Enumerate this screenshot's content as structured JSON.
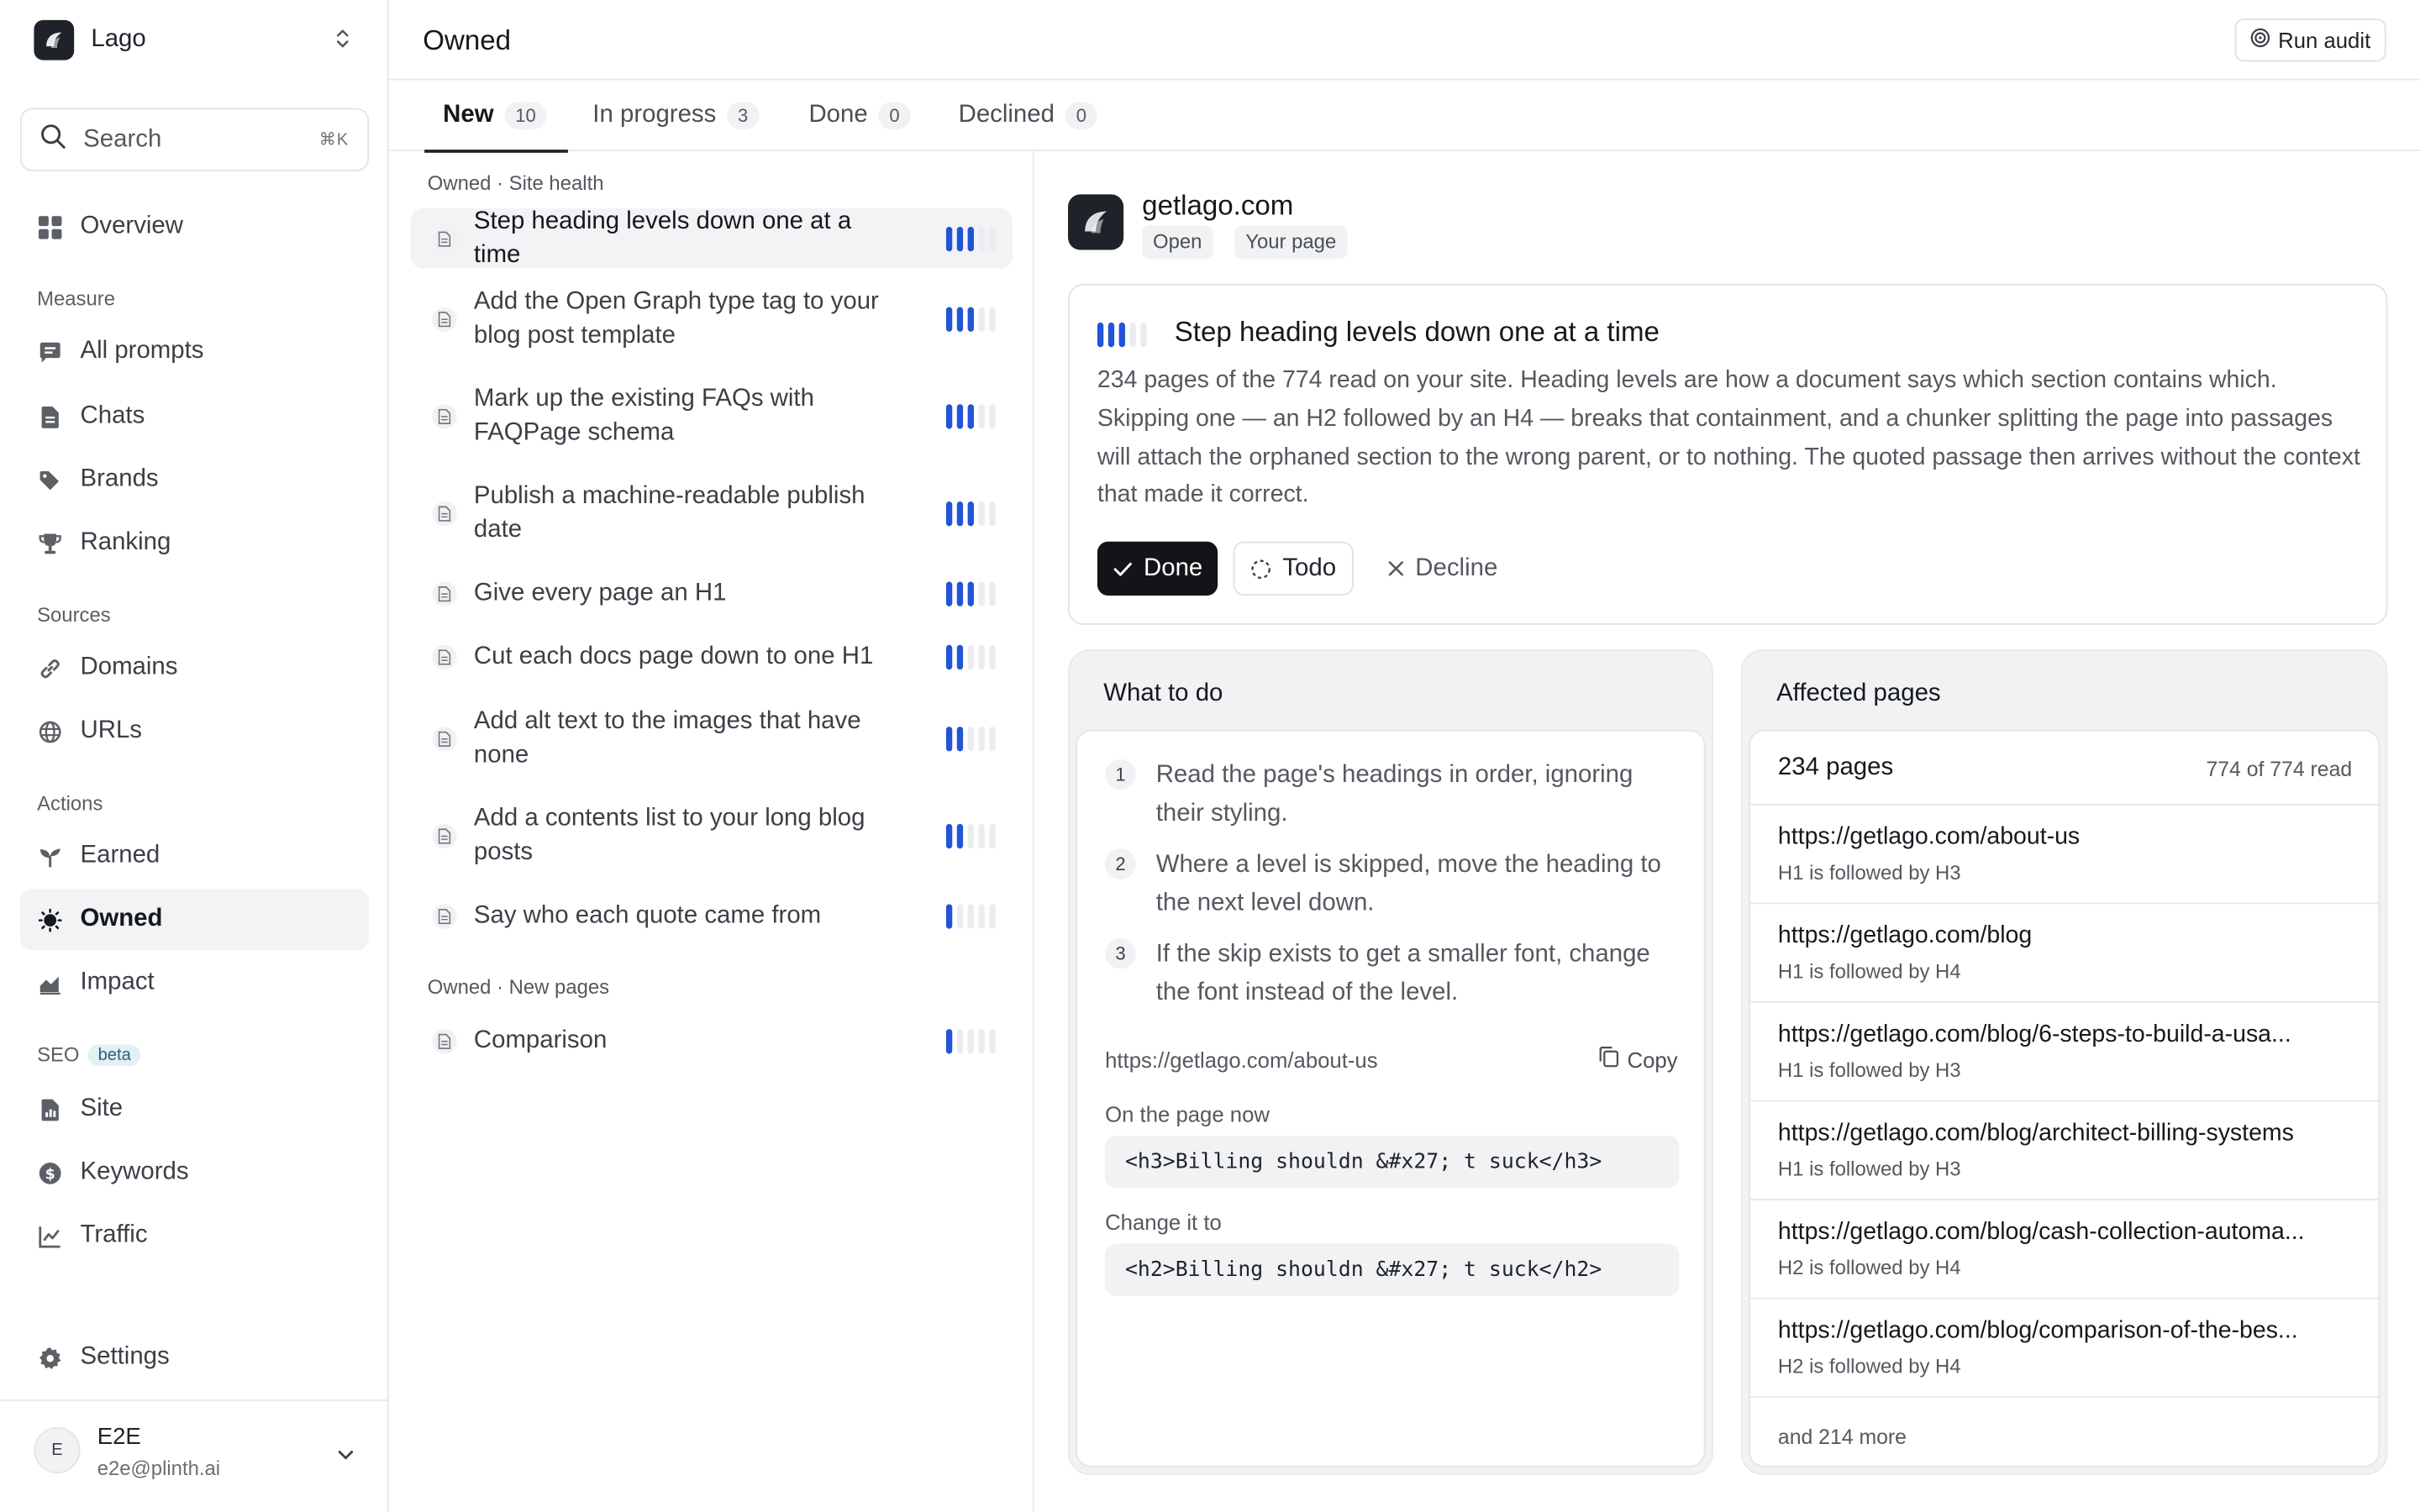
{
  "workspace": {
    "name": "Lago"
  },
  "search": {
    "label": "Search",
    "shortcut": "⌘K"
  },
  "nav": {
    "overview": "Overview",
    "measure_label": "Measure",
    "all_prompts": "All prompts",
    "chats": "Chats",
    "brands": "Brands",
    "ranking": "Ranking",
    "sources_label": "Sources",
    "domains": "Domains",
    "urls": "URLs",
    "actions_label": "Actions",
    "earned": "Earned",
    "owned": "Owned",
    "impact": "Impact",
    "seo_label": "SEO",
    "seo_badge": "beta",
    "site": "Site",
    "keywords": "Keywords",
    "traffic": "Traffic",
    "settings": "Settings"
  },
  "user": {
    "initial": "E",
    "name": "E2E",
    "email": "e2e@plinth.ai"
  },
  "header": {
    "title": "Owned",
    "run_audit": "Run audit"
  },
  "tabs": [
    {
      "label": "New",
      "count": "10"
    },
    {
      "label": "In progress",
      "count": "3"
    },
    {
      "label": "Done",
      "count": "0"
    },
    {
      "label": "Declined",
      "count": "0"
    }
  ],
  "groups": {
    "site_health": "Owned · Site health",
    "new_pages": "Owned · New pages"
  },
  "recommendations": [
    {
      "title": "Step heading levels down one at a time",
      "level": 3
    },
    {
      "title": "Add the Open Graph type tag to your blog post template",
      "level": 3
    },
    {
      "title": "Mark up the existing FAQs with FAQPage schema",
      "level": 3
    },
    {
      "title": "Publish a machine-readable publish date",
      "level": 3
    },
    {
      "title": "Give every page an H1",
      "level": 3
    },
    {
      "title": "Cut each docs page down to one H1",
      "level": 2
    },
    {
      "title": "Add alt text to the images that have none",
      "level": 2
    },
    {
      "title": "Add a contents list to your long blog posts",
      "level": 2
    },
    {
      "title": "Say who each quote came from",
      "level": 1
    },
    {
      "title": "Comparison",
      "level": 1
    }
  ],
  "detail": {
    "site": "getlago.com",
    "chips": [
      "Open",
      "Your page"
    ],
    "title": "Step heading levels down one at a time",
    "level": 3,
    "body": "234 pages of the 774 read on your site. Heading levels are how a document says which section contains which. Skipping one — an H2 followed by an H4 — breaks that containment, and a chunker splitting the page into passages will attach the orphaned section to the wrong parent, or to nothing. The quoted passage then arrives without the context that made it correct.",
    "buttons": {
      "done": "Done",
      "todo": "Todo",
      "decline": "Decline"
    }
  },
  "what_to_do": {
    "title": "What to do",
    "steps": [
      {
        "num": "1",
        "text": "Read the page's headings in order, ignoring their styling."
      },
      {
        "num": "2",
        "text": "Where a level is skipped, move the heading to the next level down."
      },
      {
        "num": "3",
        "text": "If the skip exists to get a smaller font, change the font instead of the level."
      }
    ],
    "example_url": "https://getlago.com/about-us",
    "copy": "Copy",
    "now_label": "On the page now",
    "now_code": "<h3>Billing shouldn &#x27; t suck</h3>",
    "change_label": "Change it to",
    "change_code": "<h2>Billing shouldn &#x27; t suck</h2>"
  },
  "affected": {
    "title": "Affected pages",
    "count": "234 pages",
    "read": "774 of 774 read",
    "pages": [
      {
        "url": "https://getlago.com/about-us",
        "note": "H1 is followed by H3"
      },
      {
        "url": "https://getlago.com/blog",
        "note": "H1 is followed by H4"
      },
      {
        "url": "https://getlago.com/blog/6-steps-to-build-a-usa...",
        "note": "H1 is followed by H3"
      },
      {
        "url": "https://getlago.com/blog/architect-billing-systems",
        "note": "H1 is followed by H3"
      },
      {
        "url": "https://getlago.com/blog/cash-collection-automa...",
        "note": "H2 is followed by H4"
      },
      {
        "url": "https://getlago.com/blog/comparison-of-the-bes...",
        "note": "H2 is followed by H4"
      }
    ],
    "more": "and 214 more"
  },
  "colors": {
    "accent": "#2254d6",
    "dark": "#121417",
    "muted": "#55585f"
  }
}
